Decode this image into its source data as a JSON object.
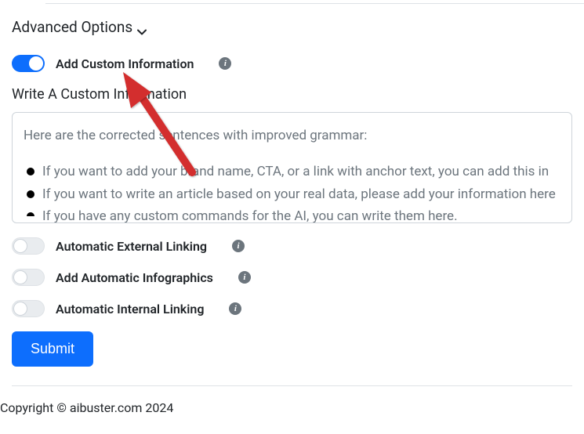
{
  "advanced_options": {
    "label": "Advanced Options"
  },
  "toggles": {
    "custom_info": {
      "label": "Add Custom Information",
      "on": true
    },
    "ext_link": {
      "label": "Automatic External Linking",
      "on": false
    },
    "infographics": {
      "label": "Add Automatic Infographics",
      "on": false
    },
    "int_link": {
      "label": "Automatic Internal Linking",
      "on": false
    }
  },
  "custom_section": {
    "heading": "Write A Custom Information",
    "intro": "Here are the corrected sentences with improved grammar:",
    "bullets": [
      "If you want to add your brand name, CTA, or a link with anchor text, you can add this in",
      "If you want to write an article based on your real data, please add your information here",
      "If you have any custom commands for the AI, you can write them here."
    ]
  },
  "submit": {
    "label": "Submit"
  },
  "footer": {
    "text": "Copyright © aibuster.com 2024"
  }
}
